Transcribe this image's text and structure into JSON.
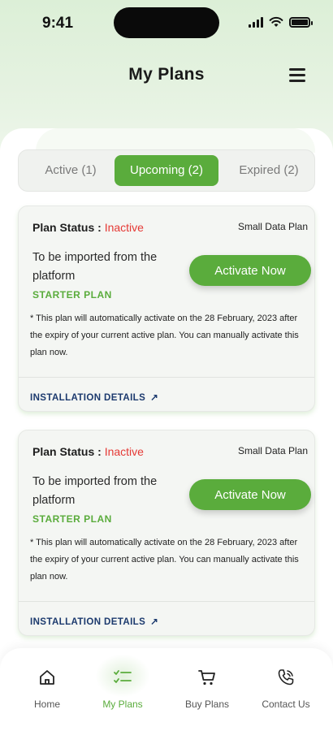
{
  "status_bar": {
    "time": "9:41"
  },
  "header": {
    "title": "My Plans"
  },
  "tabs": [
    {
      "label": "Active (1)",
      "active": false
    },
    {
      "label": "Upcoming (2)",
      "active": true
    },
    {
      "label": "Expired (2)",
      "active": false
    }
  ],
  "plans": [
    {
      "status_label": "Plan Status :",
      "status_value": "Inactive",
      "plan_type": "Small Data Plan",
      "description": "To be imported from the platform",
      "plan_name": "STARTER PLAN",
      "activate_label": "Activate Now",
      "note": "* This plan will automatically activate on the 28 February, 2023 after the expiry of your current active plan. You can manually activate this plan now.",
      "installation_label": "INSTALLATION DETAILS"
    },
    {
      "status_label": "Plan Status :",
      "status_value": "Inactive",
      "plan_type": "Small Data Plan",
      "description": "To be imported from the platform",
      "plan_name": "STARTER PLAN",
      "activate_label": "Activate Now",
      "note": "* This plan will automatically activate on the 28 February, 2023 after the expiry of your current active plan. You can manually activate this plan now.",
      "installation_label": "INSTALLATION DETAILS"
    }
  ],
  "bottom_nav": [
    {
      "label": "Home",
      "icon": "home-icon",
      "active": false
    },
    {
      "label": "My Plans",
      "icon": "checklist-icon",
      "active": true
    },
    {
      "label": "Buy Plans",
      "icon": "cart-icon",
      "active": false
    },
    {
      "label": "Contact Us",
      "icon": "phone-icon",
      "active": false
    }
  ],
  "colors": {
    "accent": "#5aac3c",
    "status_inactive": "#e53935",
    "link": "#1c3a6e"
  }
}
